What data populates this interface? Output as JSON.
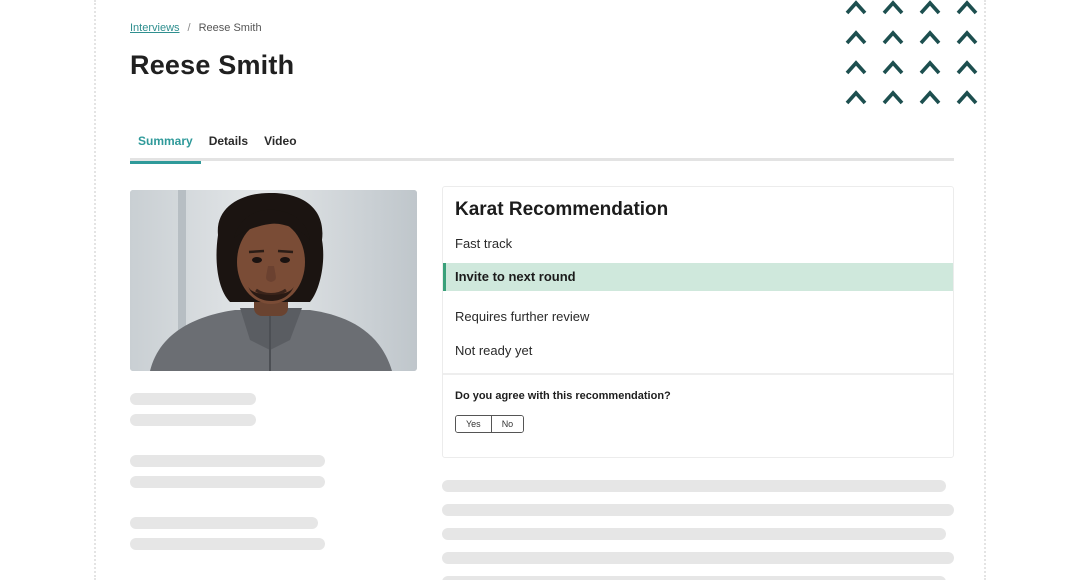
{
  "breadcrumb": {
    "parent": "Interviews",
    "separator": "/",
    "current": "Reese Smith"
  },
  "page_title": "Reese Smith",
  "tabs": [
    {
      "label": "Summary",
      "active": true
    },
    {
      "label": "Details",
      "active": false
    },
    {
      "label": "Video",
      "active": false
    }
  ],
  "recommendation": {
    "title": "Karat Recommendation",
    "options": [
      {
        "label": "Fast track",
        "selected": false
      },
      {
        "label": "Invite to next round",
        "selected": true
      },
      {
        "label": "Requires further review",
        "selected": false
      },
      {
        "label": "Not ready yet",
        "selected": false
      }
    ],
    "question": "Do you agree with this recommendation?",
    "yes_label": "Yes",
    "no_label": "No"
  },
  "colors": {
    "accent": "#2f9a9a",
    "selected_bg": "#cfe8dc",
    "selected_border": "#3aa07a",
    "chevron": "#1d4f4f"
  },
  "decorations": {
    "chevron_icon": "chevron-up-icon"
  }
}
